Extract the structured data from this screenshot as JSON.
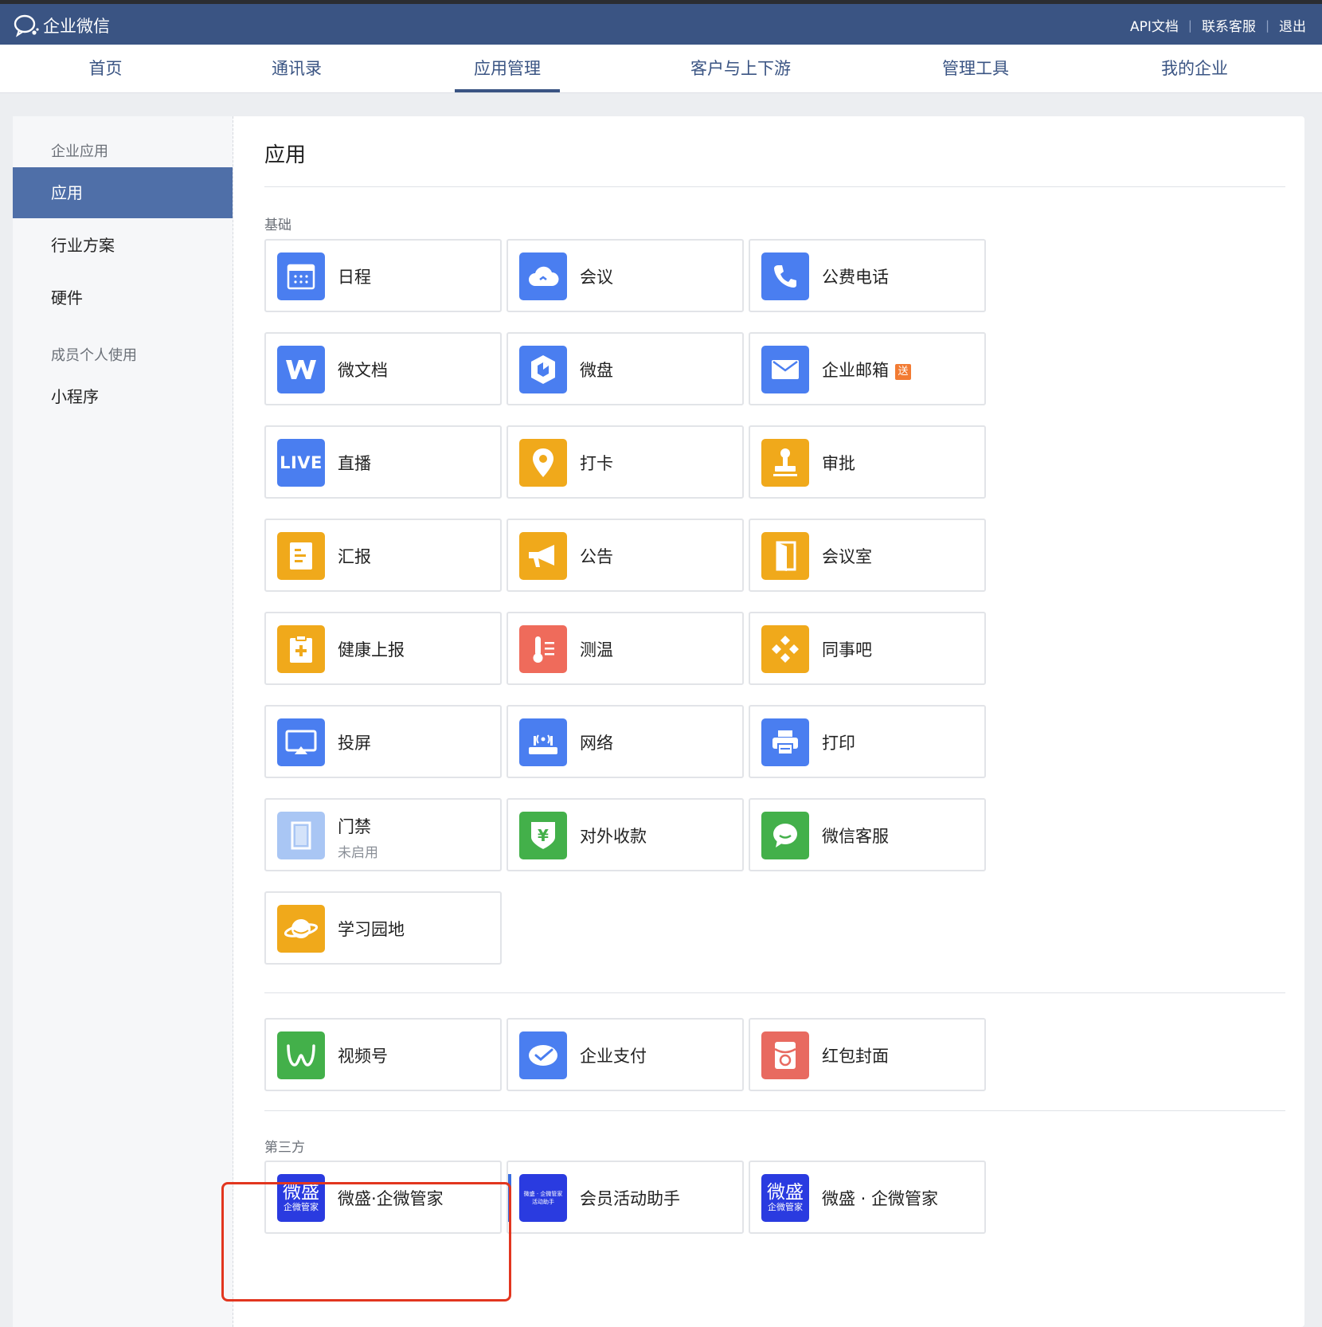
{
  "header": {
    "logo_text": "企业微信",
    "links": [
      "API文档",
      "联系客服",
      "退出"
    ]
  },
  "nav": {
    "items": [
      "首页",
      "通讯录",
      "应用管理",
      "客户与上下游",
      "管理工具",
      "我的企业"
    ],
    "active_index": 2
  },
  "sidebar": {
    "group1_label": "企业应用",
    "items": [
      "应用",
      "行业方案",
      "硬件"
    ],
    "active_item": "应用",
    "group2_label": "成员个人使用",
    "items2": [
      "小程序"
    ]
  },
  "main": {
    "title": "应用",
    "basic_section_label": "基础",
    "basic_apps": [
      {
        "name": "日程",
        "icon": "calendar-icon",
        "color": "#4a7ef0"
      },
      {
        "name": "会议",
        "icon": "cloud-meeting-icon",
        "color": "#4a7ef0"
      },
      {
        "name": "公费电话",
        "icon": "phone-icon",
        "color": "#4a7ef0"
      },
      {
        "name": "微文档",
        "icon": "w-doc-icon",
        "color": "#4a7ef0"
      },
      {
        "name": "微盘",
        "icon": "drive-cube-icon",
        "color": "#4a7ef0"
      },
      {
        "name": "企业邮箱",
        "icon": "mail-icon",
        "color": "#4a7ef0",
        "badge": "送"
      },
      {
        "name": "直播",
        "icon": "live-icon",
        "color": "#4a7ef0",
        "icon_text": "LIVE"
      },
      {
        "name": "打卡",
        "icon": "location-pin-icon",
        "color": "#f0a91b"
      },
      {
        "name": "审批",
        "icon": "stamp-icon",
        "color": "#f0a91b"
      },
      {
        "name": "汇报",
        "icon": "report-icon",
        "color": "#f0a91b"
      },
      {
        "name": "公告",
        "icon": "megaphone-icon",
        "color": "#f0a91b"
      },
      {
        "name": "会议室",
        "icon": "door-icon",
        "color": "#f0a91b"
      },
      {
        "name": "健康上报",
        "icon": "health-report-icon",
        "color": "#f0a91b"
      },
      {
        "name": "测温",
        "icon": "thermometer-icon",
        "color": "#ef6b5b"
      },
      {
        "name": "同事吧",
        "icon": "community-icon",
        "color": "#f0a91b"
      },
      {
        "name": "投屏",
        "icon": "screencast-icon",
        "color": "#4a7ef0"
      },
      {
        "name": "网络",
        "icon": "router-icon",
        "color": "#4a7ef0"
      },
      {
        "name": "打印",
        "icon": "printer-icon",
        "color": "#4a7ef0"
      },
      {
        "name": "门禁",
        "icon": "access-door-icon",
        "color": "#a9c6f4",
        "status": "未启用"
      },
      {
        "name": "对外收款",
        "icon": "payment-shield-icon",
        "color": "#43b04a",
        "icon_text": "¥"
      },
      {
        "name": "微信客服",
        "icon": "wechat-service-icon",
        "color": "#43b04a"
      },
      {
        "name": "学习园地",
        "icon": "planet-icon",
        "color": "#f0a91b"
      }
    ],
    "wechat_apps": [
      {
        "name": "视频号",
        "icon": "channels-icon",
        "color": "#43b04a"
      },
      {
        "name": "企业支付",
        "icon": "pay-icon",
        "color": "#4a7ef0"
      },
      {
        "name": "红包封面",
        "icon": "red-packet-icon",
        "color": "#e86a60"
      }
    ],
    "third_party_label": "第三方",
    "third_party_apps": [
      {
        "name": "微盛·企微管家",
        "icon": "weisheng-icon",
        "color": "#2a3be0",
        "icon_big": "微盛",
        "icon_small": "企微管家"
      },
      {
        "name": "会员活动助手",
        "icon": "member-activity-icon",
        "color": "#2a3be0",
        "icon_small": "微盛 · 企微管家",
        "icon_small2": "活动助手"
      },
      {
        "name": "微盛 · 企微管家",
        "icon": "weisheng-icon",
        "color": "#2a3be0",
        "icon_big": "微盛",
        "icon_small": "企微管家"
      }
    ]
  },
  "colors": {
    "header_bg": "#3a5483",
    "sidebar_active": "#4f6fa8",
    "highlight_box": "#e2361f"
  }
}
